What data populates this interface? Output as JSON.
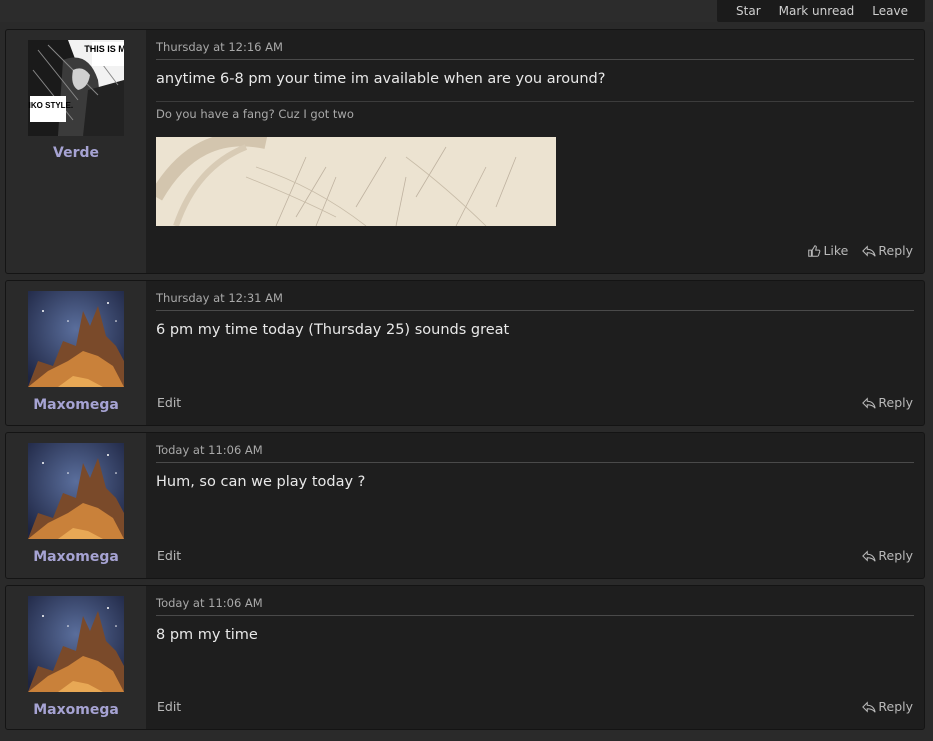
{
  "topbar": {
    "star": "Star",
    "mark_unread": "Mark unread",
    "leave": "Leave"
  },
  "messages": [
    {
      "user": "Verde",
      "date": "Thursday at 12:16 AM",
      "text": "anytime 6-8 pm your time im available when are you around?",
      "signature": "Do you have a fang? Cuz I got two",
      "like": "Like",
      "reply": "Reply"
    },
    {
      "user": "Maxomega",
      "date": "Thursday at 12:31 AM",
      "text": "6 pm my time today (Thursday 25) sounds great",
      "edit": "Edit",
      "reply": "Reply"
    },
    {
      "user": "Maxomega",
      "date": "Today at 11:06 AM",
      "text": "Hum, so can we play today ?",
      "edit": "Edit",
      "reply": "Reply"
    },
    {
      "user": "Maxomega",
      "date": "Today at 11:06 AM",
      "text": "8 pm my time",
      "edit": "Edit",
      "reply": "Reply"
    }
  ],
  "avatar_verde_text": [
    "THIS IS MY",
    "NIKO STYLE."
  ],
  "colors": {
    "username": "#a6a3d3",
    "panel": "#1e1e1e",
    "sidebar": "#2a2a2a"
  }
}
